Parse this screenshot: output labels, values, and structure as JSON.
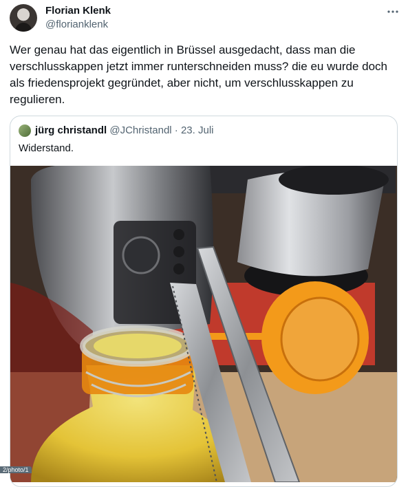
{
  "tweet": {
    "author_name": "Florian Klenk",
    "author_handle": "@florianklenk",
    "text": "Wer genau hat das eigentlich in Brüssel ausgedacht, dass man die verschlusskappen jetzt immer runterschneiden muss? die eu wurde doch als friedensprojekt gegründet, aber nicht, um verschlusskappen zu regulieren."
  },
  "quote": {
    "author_name": "jürg christandl",
    "author_handle": "@JChristandl",
    "separator": " · ",
    "date": "23. Juli",
    "text": "Widerstand."
  },
  "status_hint": "2/photo/1",
  "icons": {
    "more": "more-horizontal-icon",
    "avatar": "user-avatar",
    "photo": "photo-bottle-cap-scissors"
  },
  "colors": {
    "text": "#0f1419",
    "secondary": "#536471",
    "border": "#cfd9de",
    "cap_orange": "#f39a1a"
  }
}
